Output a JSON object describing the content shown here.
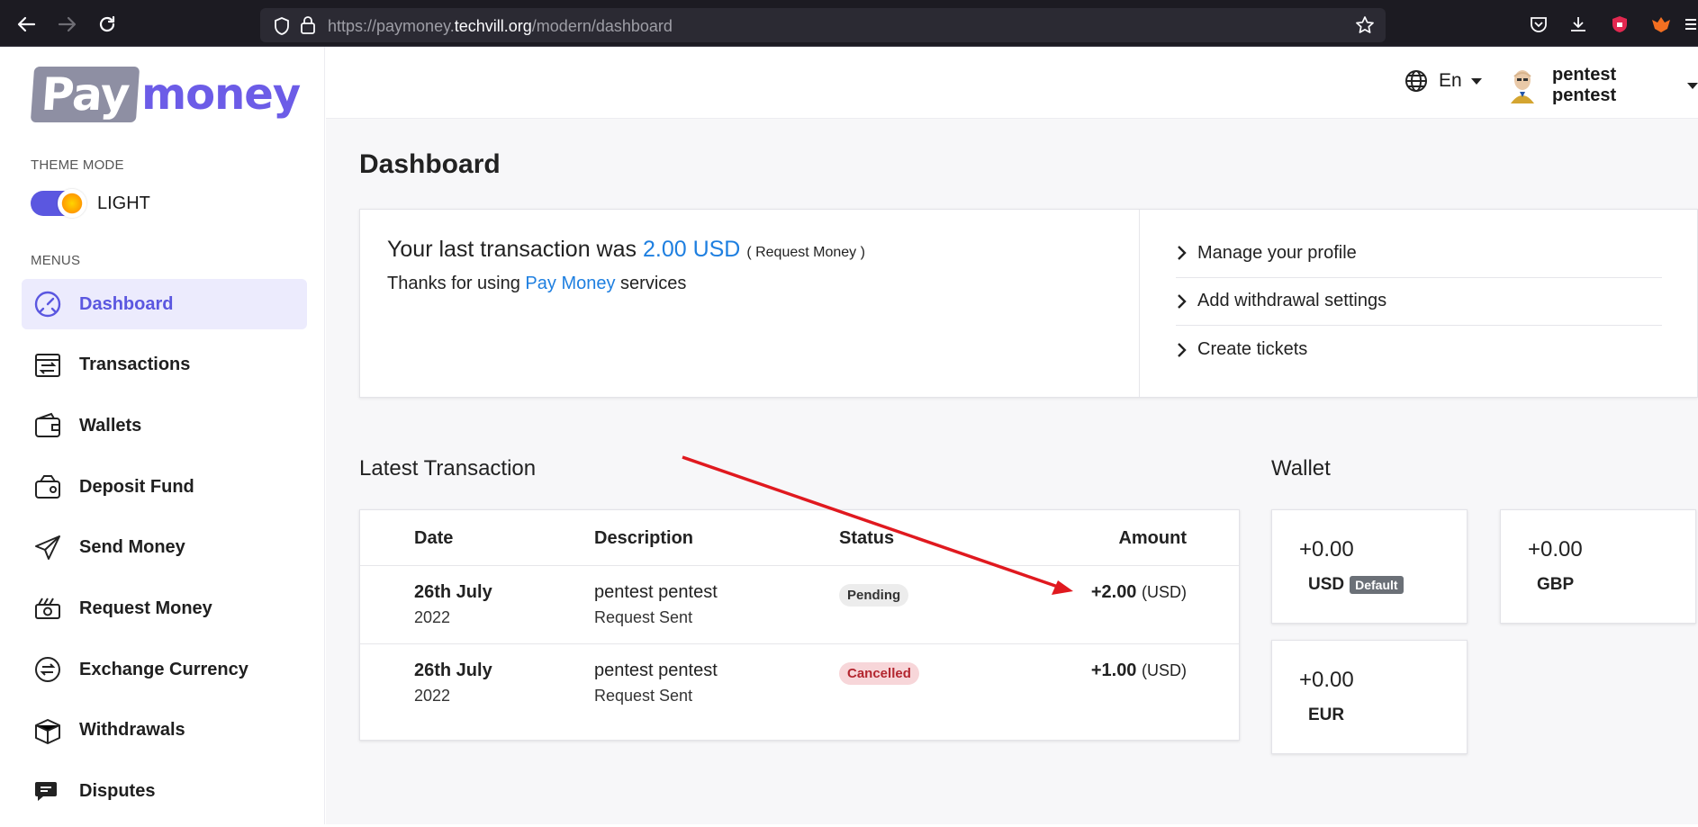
{
  "browser": {
    "url_prefix": "https://paymoney.",
    "url_host": "techvill.org",
    "url_path": "/modern/dashboard"
  },
  "sidebar": {
    "logo_pay": "Pay",
    "logo_money": "money",
    "theme_mode_label": "THEME MODE",
    "theme_value": "LIGHT",
    "menus_label": "MENUS",
    "items": [
      {
        "label": "Dashboard",
        "icon": "dashboard-gauge-icon",
        "active": true
      },
      {
        "label": "Transactions",
        "icon": "transactions-icon"
      },
      {
        "label": "Wallets",
        "icon": "wallet-icon"
      },
      {
        "label": "Deposit Fund",
        "icon": "deposit-icon"
      },
      {
        "label": "Send Money",
        "icon": "send-paper-plane-icon"
      },
      {
        "label": "Request Money",
        "icon": "request-money-icon"
      },
      {
        "label": "Exchange Currency",
        "icon": "exchange-icon"
      },
      {
        "label": "Withdrawals",
        "icon": "withdrawal-box-icon"
      },
      {
        "label": "Disputes",
        "icon": "disputes-chat-icon"
      }
    ]
  },
  "header": {
    "language": "En",
    "user_name": "pentest pentest"
  },
  "main": {
    "page_title": "Dashboard",
    "last_tx_prefix": "Your last transaction was",
    "last_tx_amount": "2.00 USD",
    "last_tx_kind": "( Request Money )",
    "thanks_prefix": "Thanks for using",
    "thanks_brand": "Pay Money",
    "thanks_suffix": "services",
    "quick_links": [
      "Manage your profile",
      "Add withdrawal settings",
      "Create tickets"
    ],
    "latest_title": "Latest Transaction",
    "wallet_title": "Wallet",
    "table_headers": {
      "date": "Date",
      "description": "Description",
      "status": "Status",
      "amount": "Amount"
    },
    "transactions": [
      {
        "date_main": "26th July",
        "date_year": "2022",
        "desc_main": "pentest pentest",
        "desc_sub": "Request Sent",
        "status": "Pending",
        "amount": "+2.00",
        "currency": "(USD)"
      },
      {
        "date_main": "26th July",
        "date_year": "2022",
        "desc_main": "pentest pentest",
        "desc_sub": "Request Sent",
        "status": "Cancelled",
        "amount": "+1.00",
        "currency": "(USD)"
      }
    ],
    "wallets": [
      {
        "amount": "+0.00",
        "currency": "USD",
        "default_label": "Default"
      },
      {
        "amount": "+0.00",
        "currency": "GBP"
      },
      {
        "amount": "+0.00",
        "currency": "EUR"
      }
    ]
  },
  "colors": {
    "accent": "#5b57e0",
    "link": "#1e7fe0",
    "annotation": "#e0191f"
  }
}
